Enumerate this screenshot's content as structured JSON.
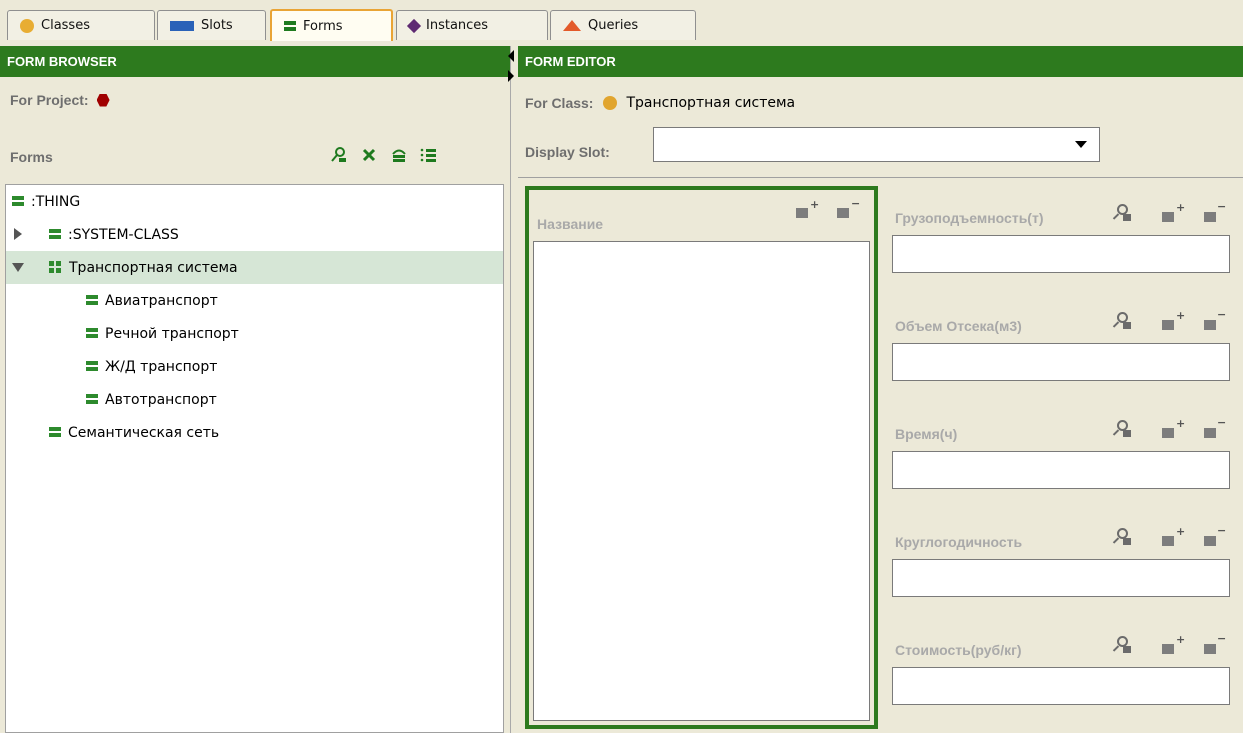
{
  "tabs": [
    {
      "label": "Classes",
      "icon": "class-circle-icon",
      "color": "#e8ad33"
    },
    {
      "label": "Slots",
      "icon": "slot-rect-icon",
      "color": "#2a62b8"
    },
    {
      "label": "Forms",
      "icon": "form-icon",
      "color": "#1f7a1f",
      "active": true
    },
    {
      "label": "Instances",
      "icon": "instance-diamond-icon",
      "color": "#5e2a72"
    },
    {
      "label": "Queries",
      "icon": "query-triangle-icon",
      "color": "#e35a2a"
    }
  ],
  "form_browser": {
    "title": "FORM BROWSER",
    "for_project_label": "For Project:",
    "forms_label": "Forms",
    "toolbar_icons": [
      "view-form-icon",
      "remove-customizations-icon",
      "relayout-icon",
      "layout-like-icon"
    ],
    "tree": [
      {
        "label": ":THING",
        "level": 0,
        "icon": "form-icon"
      },
      {
        "label": ":SYSTEM-CLASS",
        "level": 1,
        "icon": "form-icon",
        "expander": "collapsed"
      },
      {
        "label": "Транспортная система",
        "level": 1,
        "icon": "form-grid-icon",
        "expander": "expanded",
        "selected": true
      },
      {
        "label": "Авиатранспорт",
        "level": 2,
        "icon": "form-icon"
      },
      {
        "label": "Речной транспорт",
        "level": 2,
        "icon": "form-icon"
      },
      {
        "label": "Ж/Д транспорт",
        "level": 2,
        "icon": "form-icon"
      },
      {
        "label": "Автотранспорт",
        "level": 2,
        "icon": "form-icon"
      },
      {
        "label": "Семантическая сеть",
        "level": 1,
        "icon": "form-icon"
      }
    ]
  },
  "form_editor": {
    "title": "FORM EDITOR",
    "for_class_label": "For Class:",
    "for_class_value": "Транспортная система",
    "display_slot_label": "Display Slot:",
    "display_slot_value": "",
    "main_widget_label": "Название",
    "fields": [
      {
        "label": "Грузоподъемность(т)"
      },
      {
        "label": "Объем Отсека(м3)"
      },
      {
        "label": "Время(ч)"
      },
      {
        "label": "Круглогодичность"
      },
      {
        "label": "Стоимость(руб/кг)"
      }
    ],
    "colors": {
      "header": "#2d7a1e",
      "selection_border": "#2d7a1e",
      "selected_row": "#d6e6d6"
    }
  }
}
